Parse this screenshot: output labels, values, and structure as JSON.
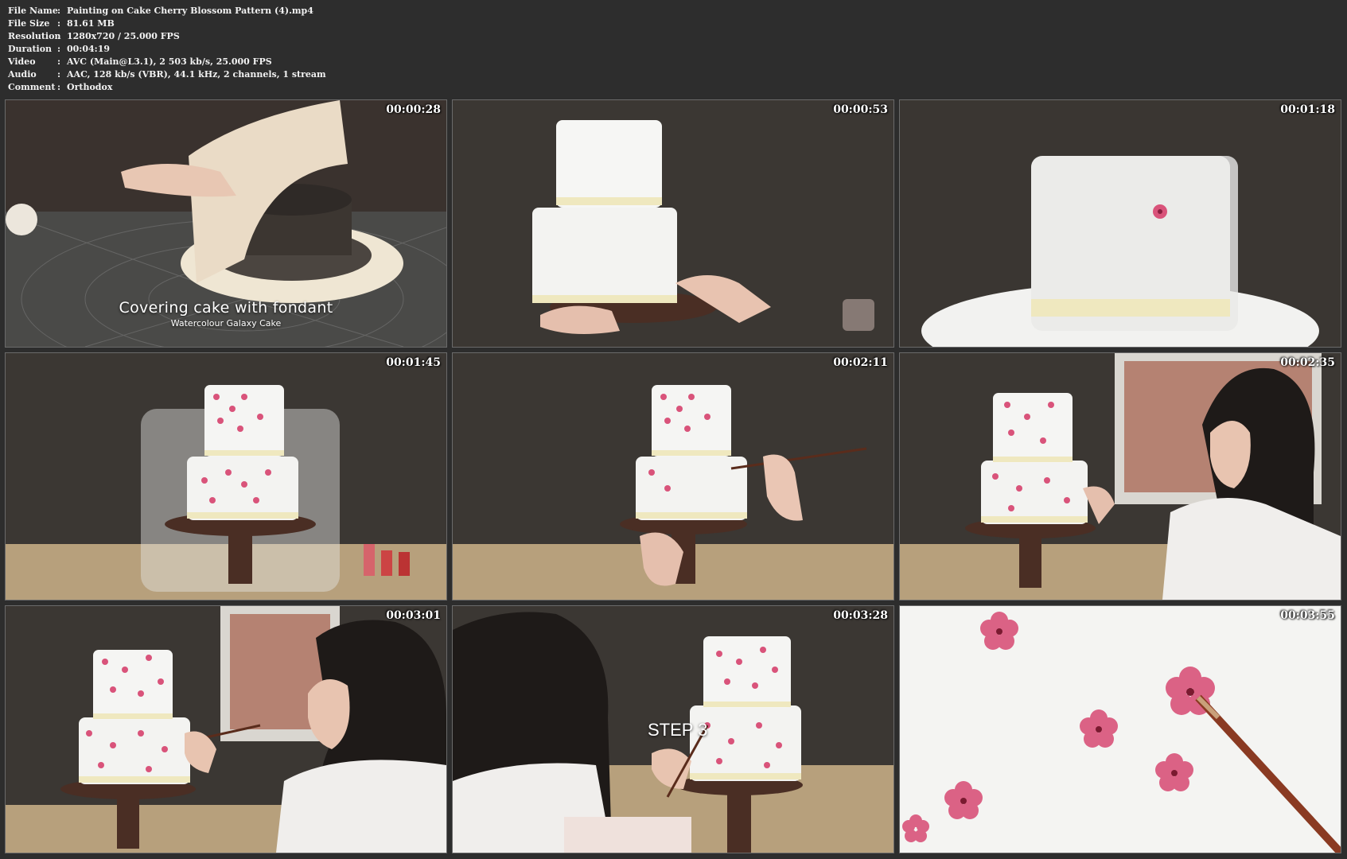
{
  "file_info": [
    {
      "label": "File Name",
      "value": "Painting on Cake  Cherry Blossom Pattern (4).mp4"
    },
    {
      "label": "File Size",
      "value": "81.61 MB"
    },
    {
      "label": "Resolution",
      "value": "1280x720 / 25.000 FPS"
    },
    {
      "label": "Duration",
      "value": "00:04:19"
    },
    {
      "label": "Video",
      "value": "AVC (Main@L3.1), 2 503 kb/s, 25.000 FPS"
    },
    {
      "label": "Audio",
      "value": "AAC, 128 kb/s (VBR), 44.1 kHz, 2 channels, 1 stream"
    },
    {
      "label": "Comment",
      "value": "Orthodox"
    }
  ],
  "separator": ":",
  "thumbnails": [
    {
      "timestamp": "00:00:28",
      "caption": "Covering cake with fondant",
      "subcaption": "Watercolour Galaxy Cake"
    },
    {
      "timestamp": "00:00:53"
    },
    {
      "timestamp": "00:01:18"
    },
    {
      "timestamp": "00:01:45"
    },
    {
      "timestamp": "00:02:11"
    },
    {
      "timestamp": "00:02:35"
    },
    {
      "timestamp": "00:03:01"
    },
    {
      "timestamp": "00:03:28",
      "caption": "STEP 3"
    },
    {
      "timestamp": "00:03:55"
    }
  ],
  "colors": {
    "background": "#2d2d2d",
    "fondant": "#f4f4f2",
    "ribbon": "#f1ecc4",
    "blossom": "#d9537a",
    "wall": "#3b3733",
    "table": "#b7a07c"
  }
}
